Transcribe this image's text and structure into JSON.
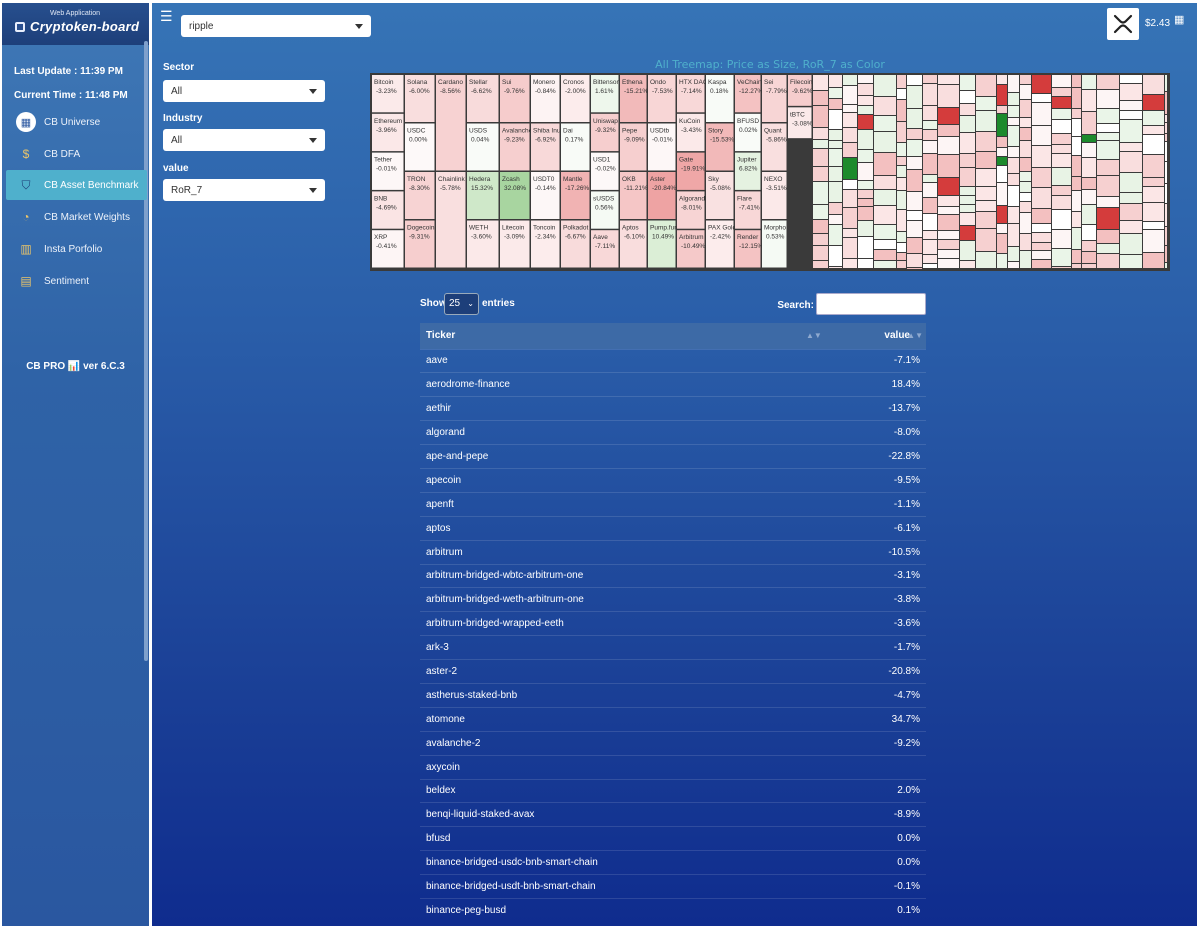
{
  "app": {
    "subtitle": "Web Application",
    "title": "Cryptoken-board",
    "version": "CB PRO 📊 ver 6.C.3"
  },
  "info": {
    "last_update": "Last Update : 11:39 PM",
    "current_time": "Current Time : 11:48 PM"
  },
  "nav": [
    {
      "label": "CB Universe",
      "icon": "grid-icon",
      "active": false
    },
    {
      "label": "CB DFA",
      "icon": "dollar-icon",
      "active": false
    },
    {
      "label": "CB Asset Benchmark",
      "icon": "shield-icon",
      "active": true
    },
    {
      "label": "CB Market Weights",
      "icon": "gauge-icon",
      "active": false
    },
    {
      "label": "Insta Porfolio",
      "icon": "bars-icon",
      "active": false
    },
    {
      "label": "Sentiment",
      "icon": "document-icon",
      "active": false
    }
  ],
  "top": {
    "coin_select": "ripple",
    "price": "$2.43",
    "coin_icon": "xrp-logo"
  },
  "filters": {
    "sector_label": "Sector",
    "sector_value": "All",
    "industry_label": "Industry",
    "industry_value": "All",
    "value_label": "value",
    "value_value": "RoR_7"
  },
  "treemap": {
    "title": "All Treemap: Price as Size, RoR_7 as Color",
    "tiles": [
      {
        "name": "Bitcoin",
        "value": "-3.23%",
        "color": "#fbeaea"
      },
      {
        "name": "Ethereum",
        "value": "-3.96%",
        "color": "#fbe8e8"
      },
      {
        "name": "Tether",
        "value": "-0.01%",
        "color": "#fdf7f7"
      },
      {
        "name": "BNB",
        "value": "-4.69%",
        "color": "#fae4e4"
      },
      {
        "name": "XRP",
        "value": "-0.41%",
        "color": "#fdf5f5"
      },
      {
        "name": "Solana",
        "value": "-6.00%",
        "color": "#f9dede"
      },
      {
        "name": "USDC",
        "value": "0.00%",
        "color": "#fdf9f9"
      },
      {
        "name": "TRON",
        "value": "-8.30%",
        "color": "#f7d3d3"
      },
      {
        "name": "Dogecoin",
        "value": "-9.31%",
        "color": "#f6cece"
      },
      {
        "name": "Cardano",
        "value": "-8.56%",
        "color": "#f7d2d2"
      },
      {
        "name": "Chainlink",
        "value": "-5.78%",
        "color": "#f9dfdf"
      },
      {
        "name": "Stellar",
        "value": "-6.62%",
        "color": "#f8dbdb"
      },
      {
        "name": "USDS",
        "value": "0.04%",
        "color": "#f9fbf8"
      },
      {
        "name": "Hedera",
        "value": "15.32%",
        "color": "#cfe8c9"
      },
      {
        "name": "WETH",
        "value": "-3.60%",
        "color": "#fbe9e9"
      },
      {
        "name": "Sui",
        "value": "-9.76%",
        "color": "#f6cccc"
      },
      {
        "name": "Avalanche",
        "value": "-9.23%",
        "color": "#f6cfcf"
      },
      {
        "name": "Zcash",
        "value": "32.08%",
        "color": "#a8d5a0"
      },
      {
        "name": "Litecoin",
        "value": "-3.09%",
        "color": "#fbeaea"
      },
      {
        "name": "Monero",
        "value": "-0.84%",
        "color": "#fdf3f3"
      },
      {
        "name": "Shiba Inu",
        "value": "-6.92%",
        "color": "#f8d9d9"
      },
      {
        "name": "USDT0",
        "value": "-0.14%",
        "color": "#fdf7f7"
      },
      {
        "name": "Toncoin",
        "value": "-2.34%",
        "color": "#fcecec"
      },
      {
        "name": "Cronos",
        "value": "-2.00%",
        "color": "#fcecec"
      },
      {
        "name": "Dai",
        "value": "0.17%",
        "color": "#f8fbf7"
      },
      {
        "name": "Mantle",
        "value": "-17.26%",
        "color": "#f1b3b3"
      },
      {
        "name": "Polkadot",
        "value": "-6.67%",
        "color": "#f8dbdb"
      },
      {
        "name": "Bittensor",
        "value": "1.61%",
        "color": "#eef7ec"
      },
      {
        "name": "Uniswap",
        "value": "-9.32%",
        "color": "#f6cece"
      },
      {
        "name": "USD1",
        "value": "-0.02%",
        "color": "#fdf8f8"
      },
      {
        "name": "sUSDS",
        "value": "0.56%",
        "color": "#f5faf4"
      },
      {
        "name": "Aave",
        "value": "-7.11%",
        "color": "#f8d8d8"
      },
      {
        "name": "Ethena",
        "value": "-15.21%",
        "color": "#f2baba"
      },
      {
        "name": "Pepe",
        "value": "-9.09%",
        "color": "#f6cfcf"
      },
      {
        "name": "OKB",
        "value": "-11.21%",
        "color": "#f5c6c6"
      },
      {
        "name": "Aptos",
        "value": "-6.10%",
        "color": "#f9dddd"
      },
      {
        "name": "Ondo",
        "value": "-7.53%",
        "color": "#f8d6d6"
      },
      {
        "name": "USDtb",
        "value": "-0.01%",
        "color": "#fdf7f7"
      },
      {
        "name": "Aster",
        "value": "-20.84%",
        "color": "#eea3a3"
      },
      {
        "name": "Pump.fun",
        "value": "10.49%",
        "color": "#dbeed6"
      },
      {
        "name": "HTX DAO",
        "value": "-7.14%",
        "color": "#f8d8d8"
      },
      {
        "name": "KuCoin",
        "value": "-3.43%",
        "color": "#fbe9e9"
      },
      {
        "name": "Gate",
        "value": "-19.91%",
        "color": "#efa7a7"
      },
      {
        "name": "Algorand",
        "value": "-8.01%",
        "color": "#f7d4d4"
      },
      {
        "name": "Arbitrum",
        "value": "-10.49%",
        "color": "#f5c9c9"
      },
      {
        "name": "Kaspa",
        "value": "0.18%",
        "color": "#f8fbf7"
      },
      {
        "name": "Story",
        "value": "-15.53%",
        "color": "#f2b9b9"
      },
      {
        "name": "Sky",
        "value": "-5.08%",
        "color": "#f9e1e1"
      },
      {
        "name": "PAX Gold",
        "value": "-2.42%",
        "color": "#fcecec"
      },
      {
        "name": "VeChain",
        "value": "-12.27%",
        "color": "#f4c2c2"
      },
      {
        "name": "BFUSD",
        "value": "0.02%",
        "color": "#f9fbf8"
      },
      {
        "name": "Jupiter",
        "value": "6.82%",
        "color": "#e5f2e1"
      },
      {
        "name": "Flare",
        "value": "-7.41%",
        "color": "#f8d7d7"
      },
      {
        "name": "Render",
        "value": "-12.15%",
        "color": "#f4c3c3"
      },
      {
        "name": "Sei",
        "value": "-7.79%",
        "color": "#f7d5d5"
      },
      {
        "name": "Quant",
        "value": "-5.86%",
        "color": "#f9dfdf"
      },
      {
        "name": "NEXO",
        "value": "-3.51%",
        "color": "#fbe9e9"
      },
      {
        "name": "Morpho",
        "value": "0.53%",
        "color": "#f5faf4"
      },
      {
        "name": "Filecoin",
        "value": "-9.62%",
        "color": "#f6cdcd"
      },
      {
        "name": "tBTC",
        "value": "-3.08%",
        "color": "#fbeaea"
      }
    ]
  },
  "table": {
    "show_label": "Show",
    "entries_value": "25",
    "entries_label": "entries",
    "search_label": "Search:",
    "col_ticker": "Ticker",
    "col_value": "value",
    "rows": [
      [
        "aave",
        "-7.1%"
      ],
      [
        "aerodrome-finance",
        "18.4%"
      ],
      [
        "aethir",
        "-13.7%"
      ],
      [
        "algorand",
        "-8.0%"
      ],
      [
        "ape-and-pepe",
        "-22.8%"
      ],
      [
        "apecoin",
        "-9.5%"
      ],
      [
        "apenft",
        "-1.1%"
      ],
      [
        "aptos",
        "-6.1%"
      ],
      [
        "arbitrum",
        "-10.5%"
      ],
      [
        "arbitrum-bridged-wbtc-arbitrum-one",
        "-3.1%"
      ],
      [
        "arbitrum-bridged-weth-arbitrum-one",
        "-3.8%"
      ],
      [
        "arbitrum-bridged-wrapped-eeth",
        "-3.6%"
      ],
      [
        "ark-3",
        "-1.7%"
      ],
      [
        "aster-2",
        "-20.8%"
      ],
      [
        "astherus-staked-bnb",
        "-4.7%"
      ],
      [
        "atomone",
        "34.7%"
      ],
      [
        "avalanche-2",
        "-9.2%"
      ],
      [
        "axycoin",
        ""
      ],
      [
        "beldex",
        "2.0%"
      ],
      [
        "benqi-liquid-staked-avax",
        "-8.9%"
      ],
      [
        "bfusd",
        "0.0%"
      ],
      [
        "binance-bridged-usdc-bnb-smart-chain",
        "0.0%"
      ],
      [
        "binance-bridged-usdt-bnb-smart-chain",
        "-0.1%"
      ],
      [
        "binance-peg-busd",
        "0.1%"
      ]
    ]
  }
}
